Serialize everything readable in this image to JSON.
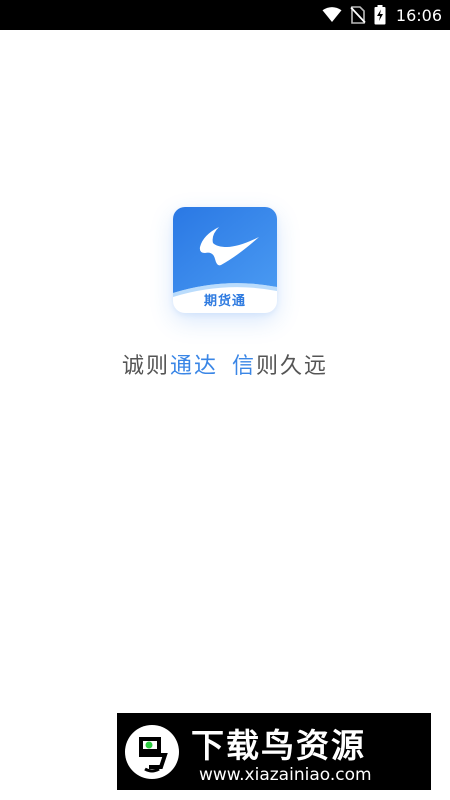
{
  "status_bar": {
    "time": "16:06",
    "icons": [
      "wifi-icon",
      "no-sim-icon",
      "battery-charging-icon"
    ]
  },
  "app": {
    "icon_name": "app-logo-icon",
    "icon_label": "期货通",
    "colors": {
      "brand_blue": "#2f7be0",
      "icon_gradient_light": "#5aa6f5"
    }
  },
  "slogan": {
    "part1": "诚则",
    "part2": "通达",
    "part3": "信",
    "part4": "则久远",
    "colors": {
      "text": "#555555",
      "accent": "#3a86e6"
    }
  },
  "watermark": {
    "title": "下载鸟资源",
    "url": "www.xiazainiao.com",
    "logo_icon": "bird-logo-icon"
  }
}
